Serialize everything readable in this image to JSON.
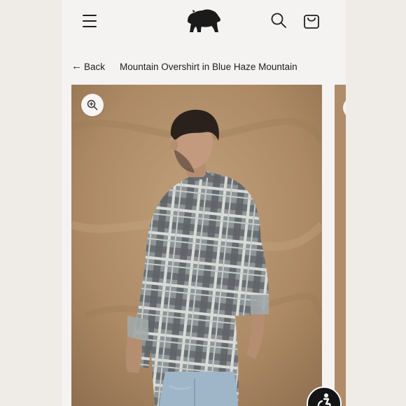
{
  "header": {
    "menu_icon": "hamburger-menu-icon",
    "logo_icon": "bear-logo-icon",
    "search_icon": "search-icon",
    "cart_icon": "shopping-bag-icon"
  },
  "breadcrumb": {
    "back_label": "Back",
    "back_icon": "arrow-left-icon",
    "product_title": "Mountain Overshirt in Blue Haze Mountain"
  },
  "gallery": {
    "zoom_icon": "zoom-in-icon",
    "accessibility_icon": "accessibility-icon"
  },
  "colors": {
    "page_background": "#f5f3f1",
    "outer_background": "#efebe6",
    "photo_backdrop": "#b08d6a",
    "text": "#1e1e1e"
  }
}
